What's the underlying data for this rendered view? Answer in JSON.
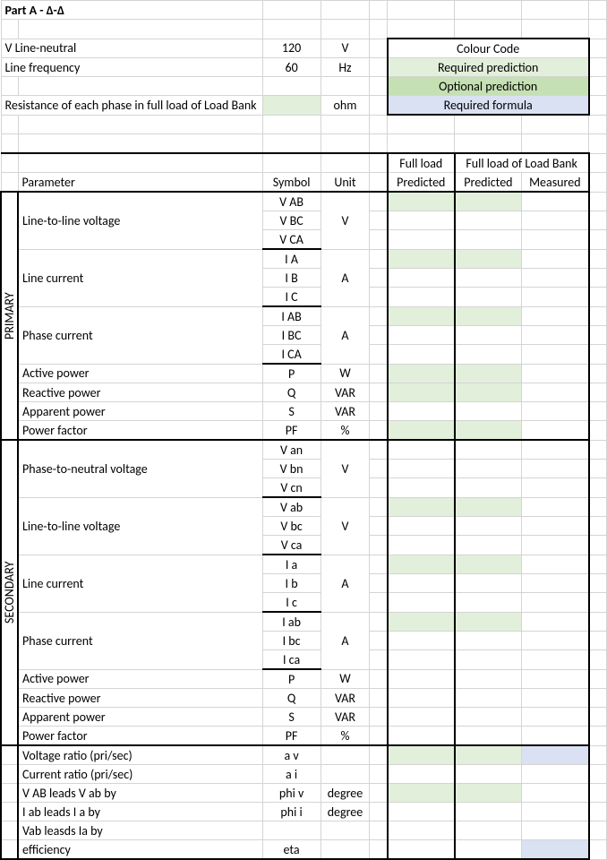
{
  "title": "Part A - Δ-Δ",
  "inputs": {
    "vln_label": "V Line-neutral",
    "vln_value": "120",
    "vln_unit": "V",
    "freq_label": "Line frequency",
    "freq_value": "60",
    "freq_unit": "Hz",
    "res_label": "Resistance of each phase in full load of Load Bank",
    "res_value": "",
    "res_unit": "ohm"
  },
  "legend": {
    "title": "Colour Code",
    "req_pred": "Required prediction",
    "opt_pred": "Optional prediction",
    "req_form": "Required formula"
  },
  "headers": {
    "parameter": "Parameter",
    "symbol": "Symbol",
    "unit": "Unit",
    "full_load": "Full load",
    "full_load_bank": "Full load of Load Bank",
    "predicted1": "Predicted",
    "predicted2": "Predicted",
    "measured": "Measured"
  },
  "sections": {
    "primary": "PRIMARY",
    "secondary": "SECONDARY"
  },
  "primary": [
    {
      "param": "Line-to-line voltage",
      "symbols": [
        "V AB",
        "V BC",
        "V CA"
      ],
      "unit": "V"
    },
    {
      "param": "Line current",
      "symbols": [
        "I A",
        "I B",
        "I C"
      ],
      "unit": "A"
    },
    {
      "param": "Phase current",
      "symbols": [
        "I AB",
        "I BC",
        "I CA"
      ],
      "unit": "A"
    },
    {
      "param": "Active power",
      "symbols": [
        "P"
      ],
      "unit": "W"
    },
    {
      "param": "Reactive power",
      "symbols": [
        "Q"
      ],
      "unit": "VAR"
    },
    {
      "param": "Apparent power",
      "symbols": [
        "S"
      ],
      "unit": "VAR"
    },
    {
      "param": "Power factor",
      "symbols": [
        "PF"
      ],
      "unit": "%"
    }
  ],
  "secondary": [
    {
      "param": "Phase-to-neutral voltage",
      "symbols": [
        "V an",
        "V bn",
        "V cn"
      ],
      "unit": "V"
    },
    {
      "param": "Line-to-line voltage",
      "symbols": [
        "V ab",
        "V bc",
        "V ca"
      ],
      "unit": "V"
    },
    {
      "param": "Line current",
      "symbols": [
        "I a",
        "I b",
        "I c"
      ],
      "unit": "A"
    },
    {
      "param": "Phase current",
      "symbols": [
        "I ab",
        "I bc",
        "I ca"
      ],
      "unit": "A"
    },
    {
      "param": "Active power",
      "symbols": [
        "P"
      ],
      "unit": "W"
    },
    {
      "param": "Reactive power",
      "symbols": [
        "Q"
      ],
      "unit": "VAR"
    },
    {
      "param": "Apparent power",
      "symbols": [
        "S"
      ],
      "unit": "VAR"
    },
    {
      "param": "Power factor",
      "symbols": [
        "PF"
      ],
      "unit": "%"
    }
  ],
  "extras": [
    {
      "param": "Voltage ratio (pri/sec)",
      "symbol": "a v",
      "unit": ""
    },
    {
      "param": "Current ratio (pri/sec)",
      "symbol": "a i",
      "unit": ""
    },
    {
      "param": "V AB leads V ab by",
      "symbol": "phi v",
      "unit": "degree"
    },
    {
      "param": "I ab leads I a by",
      "symbol": "phi i",
      "unit": "degree"
    },
    {
      "param": "Vab leasds Ia by",
      "symbol": "",
      "unit": ""
    },
    {
      "param": "efficiency",
      "symbol": "eta",
      "unit": ""
    }
  ]
}
